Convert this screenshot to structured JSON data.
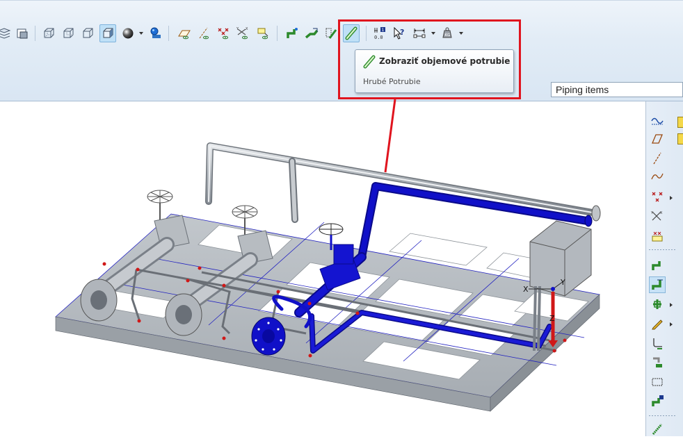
{
  "tooltip": {
    "title": "Zobraziť objemové potrubie",
    "description": "Hrubé Potrubie"
  },
  "piping_dropdown": {
    "selected": "Piping items"
  },
  "colors": {
    "highlight": "#e0141e",
    "pipe_selected": "#1010c8",
    "pipe_grey": "#b8bcc2",
    "frame_grey": "#b3b8be"
  },
  "toolbar_icons": [
    "layers-icon",
    "display-style-icon",
    "wireframe-icon",
    "hidden-line-icon",
    "no-hidden-icon",
    "shaded-icon",
    "sphere-shading-icon",
    "spin-center-icon",
    "datum-planes-icon",
    "datum-axes-icon",
    "point-display-icon",
    "csys-display-icon",
    "annotation-display-icon",
    "pipe-route-icon",
    "pipe-slope-icon",
    "pipe-centerline-icon",
    "thick-pipe-icon",
    "info-icon",
    "query-select-icon",
    "dimension-icon",
    "weight-icon"
  ],
  "viewport": {
    "csys_labels": {
      "x": "X",
      "y": "Y",
      "z": "Z"
    }
  }
}
